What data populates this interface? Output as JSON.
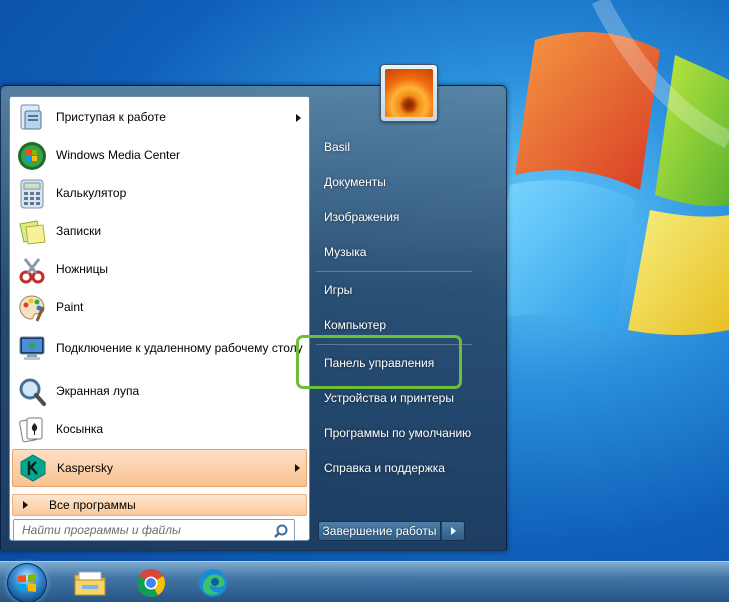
{
  "start_menu": {
    "programs": [
      {
        "label": "Приступая к работе",
        "icon": "getting-started-icon",
        "has_submenu": true
      },
      {
        "label": "Windows Media Center",
        "icon": "media-center-icon",
        "has_submenu": false
      },
      {
        "label": "Калькулятор",
        "icon": "calculator-icon",
        "has_submenu": false
      },
      {
        "label": "Записки",
        "icon": "sticky-notes-icon",
        "has_submenu": false
      },
      {
        "label": "Ножницы",
        "icon": "scissors-icon",
        "has_submenu": false
      },
      {
        "label": "Paint",
        "icon": "paint-palette-icon",
        "has_submenu": false
      },
      {
        "label": "Подключение к удаленному рабочему столу",
        "icon": "remote-desktop-icon",
        "has_submenu": false
      },
      {
        "label": "Экранная лупа",
        "icon": "magnifier-icon",
        "has_submenu": false
      },
      {
        "label": "Косынка",
        "icon": "solitaire-icon",
        "has_submenu": false
      },
      {
        "label": "Kaspersky",
        "icon": "kaspersky-icon",
        "has_submenu": true
      }
    ],
    "all_programs": "Все программы",
    "search": {
      "placeholder": "Найти программы и файлы"
    },
    "right": {
      "user": "Basil",
      "documents": "Документы",
      "pictures": "Изображения",
      "music": "Музыка",
      "games": "Игры",
      "computer": "Компьютер",
      "control_panel": "Панель управления",
      "devices": "Устройства и принтеры",
      "defaults": "Программы по умолчанию",
      "help": "Справка и поддержка"
    },
    "shutdown_label": "Завершение работы"
  },
  "taskbar": {
    "icons": [
      "windows-start-orb-icon",
      "file-explorer-icon",
      "chrome-icon",
      "edge-icon"
    ]
  },
  "colors": {
    "highlight_box": "#6dbf3b",
    "menu_hover": "#fac291",
    "desktop_blue": "#1c7fd6"
  }
}
